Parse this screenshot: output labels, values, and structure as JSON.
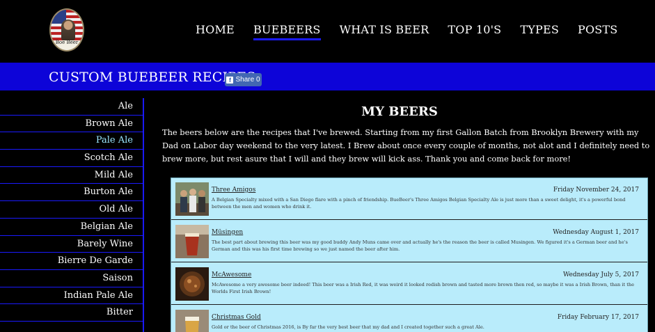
{
  "logo": {
    "text": "Boe Beer"
  },
  "nav": [
    {
      "label": "HOME"
    },
    {
      "label": "BUEBEERS",
      "active": true
    },
    {
      "label": "WHAT IS BEER"
    },
    {
      "label": "TOP 10'S"
    },
    {
      "label": "TYPES"
    },
    {
      "label": "POSTS"
    }
  ],
  "banner": {
    "title": "CUSTOM BUEBEER RECIPES",
    "share_label": "Share 0",
    "share_color": "#4267b2",
    "banner_color": "#0d04d8"
  },
  "sidebar": {
    "items": [
      {
        "label": "Ale"
      },
      {
        "label": "Brown Ale"
      },
      {
        "label": "Pale Ale",
        "active": true
      },
      {
        "label": "Scotch Ale"
      },
      {
        "label": "Mild Ale"
      },
      {
        "label": "Burton Ale"
      },
      {
        "label": "Old Ale"
      },
      {
        "label": "Belgian Ale"
      },
      {
        "label": "Barely Wine"
      },
      {
        "label": "Bierre De Garde"
      },
      {
        "label": "Saison"
      },
      {
        "label": "Indian Pale Ale"
      },
      {
        "label": "Bitter"
      }
    ]
  },
  "main": {
    "title": "MY BEERS",
    "intro": "The beers below are the recipes that I've brewed. Starting from my first Gallon Batch from Brooklyn Brewery with my Dad on Labor day weekend to the very latest. I Brew about once every couple of months, not alot and I definitely need to brew more, but rest asure that I will and they brew will kick ass. Thank you and come back for more!"
  },
  "posts": [
    {
      "title": "Three Amigos",
      "date": "Friday November 24, 2017",
      "desc": "A Belgian Specialty mixed with a San Diego flare with a pinch of friendship. BueBeer's Three Amigos Belgian Specialty Ale is just more than a sweet delight, it's a powerful bond between the men and women who drink it.",
      "thumb": "group-photo"
    },
    {
      "title": "Müsingen",
      "date": "Wednesday August 1, 2017",
      "desc": "The best part about brewing this beer was my good buddy Andy Muns came over and actually he's the reason the beer is called Musingen. We figured it's a German beer and he's German and this was his first time brewing so we just named the beer after him.",
      "thumb": "beer-glass"
    },
    {
      "title": "McAwesome",
      "date": "Wednesday July 5, 2017",
      "desc": "McAwesome a very awesome beer indeed! This beer was a Irish Red, it was weird it looked redish brown and tasted more brown then red, so maybe it was a Irish Brown, than it the Worlds First Irish Brown!",
      "thumb": "brew-pot"
    },
    {
      "title": "Christmas Gold",
      "date": "Friday February 17, 2017",
      "desc": "Gold or the beer of Christmas 2016, is By far the very best beer that my dad and I created together such a great Ale.",
      "thumb": "gold-beer"
    }
  ]
}
